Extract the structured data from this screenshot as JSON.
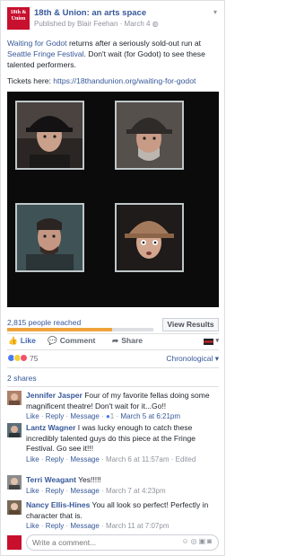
{
  "post": {
    "page_name": "18th & Union: an arts space",
    "published_prefix": "Published by",
    "author": "Blair Feehan",
    "date": "March 4",
    "avatar_text": "18th & Union",
    "text_link1": "Waiting for Godot",
    "text_part1": " returns after a seriously sold-out run at ",
    "text_link2": "Seattle Fringe Festival",
    "text_part2": ". Don't wait (for Godot) to see these talented performers.",
    "tickets_prefix": "Tickets here: ",
    "tickets_url": "https://18thandunion.org/waiting-for-godot"
  },
  "insights": {
    "reach_text": "2,815 people reached",
    "reach_fraction": 0.72,
    "view_results_label": "View Results"
  },
  "actions": {
    "like_label": "Like",
    "comment_label": "Comment",
    "share_label": "Share"
  },
  "stats": {
    "reaction_count": "75",
    "sort_label": "Chronological",
    "shares_label": "2 shares"
  },
  "comments": [
    {
      "name": "Jennifer Jasper",
      "text": " Four of my favorite fellas doing some magnificent theatre! Don't wait for it...Go!!",
      "like": "Like",
      "reply": "Reply",
      "message": "Message",
      "likes_count": "1",
      "time": "March 5 at 6:21pm",
      "edited": ""
    },
    {
      "name": "Lantz Wagner",
      "text": " I was lucky enough to catch these incredibly talented guys do this piece at the Fringe Festival. Go see it!!!",
      "like": "Like",
      "reply": "Reply",
      "message": "Message",
      "likes_count": "",
      "time": "March 6 at 11:57am",
      "edited": "Edited"
    },
    {
      "name": "Terri Weagant",
      "text": " Yes!!!!!",
      "like": "Like",
      "reply": "Reply",
      "message": "Message",
      "likes_count": "",
      "time": "March 7 at 4:23pm",
      "edited": ""
    },
    {
      "name": "Nancy Ellis-Hines",
      "text": " You all look so perfect! Perfectly in character that is.",
      "like": "Like",
      "reply": "Reply",
      "message": "Message",
      "likes_count": "",
      "time": "March 11 at 7:07pm",
      "edited": ""
    }
  ],
  "composer": {
    "placeholder": "Write a comment..."
  },
  "colors": {
    "link": "#365899",
    "brand_red": "#c8102e",
    "reach_fill": "#f0a33b"
  }
}
